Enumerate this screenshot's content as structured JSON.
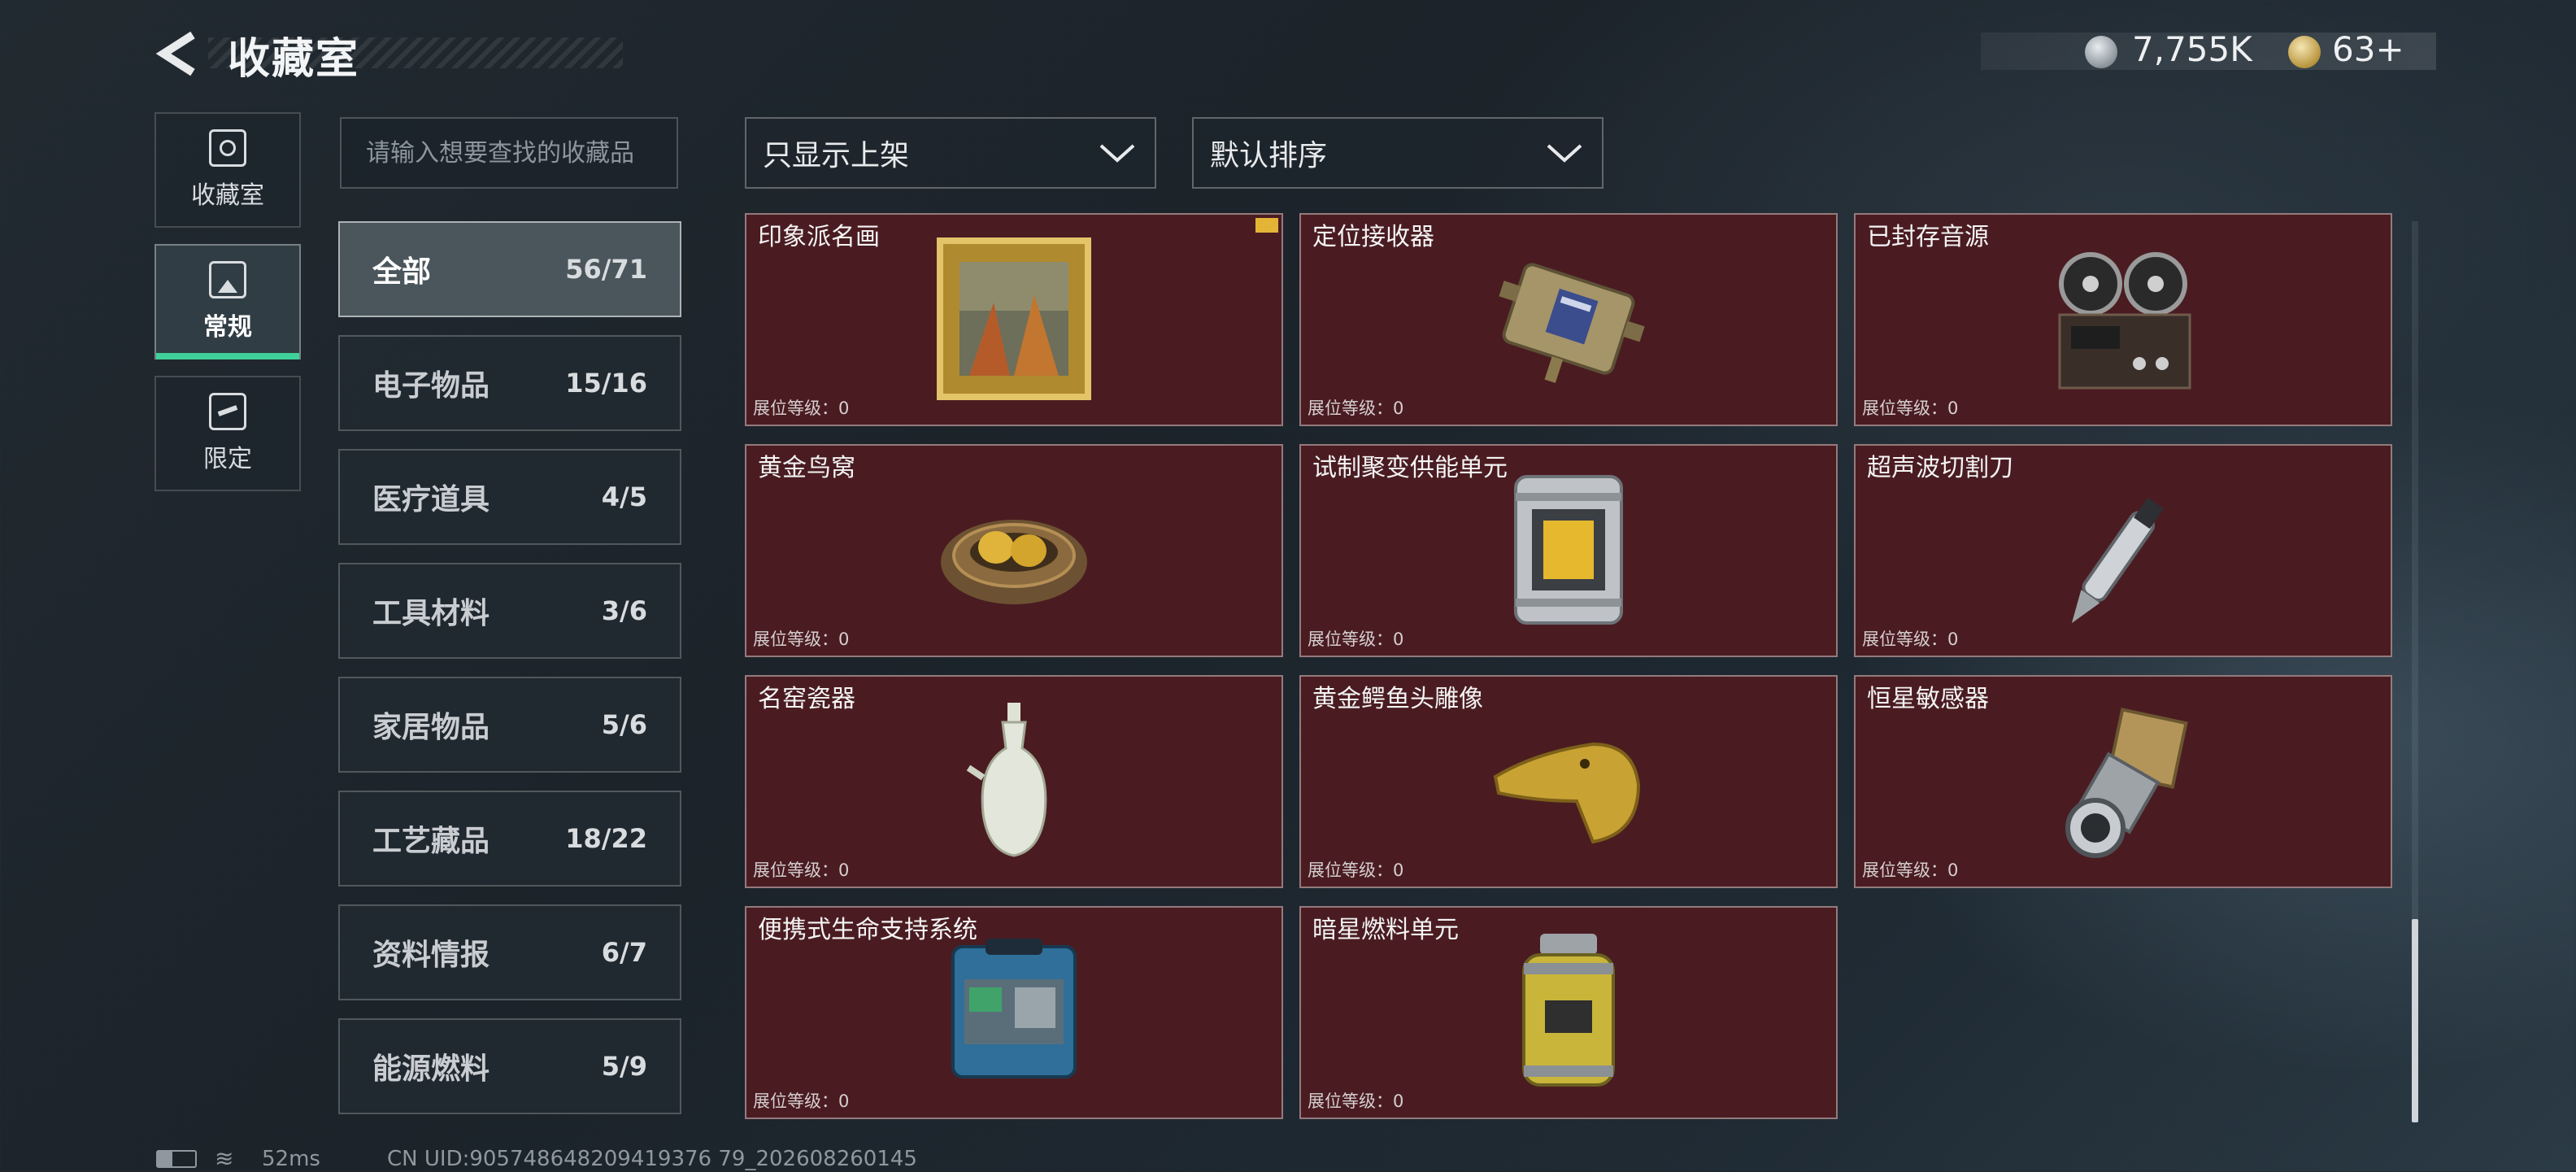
{
  "header": {
    "title": "收藏室",
    "currency_silver": "7,755K",
    "currency_gold": "63+"
  },
  "nav": [
    {
      "label": "收藏室",
      "icon": "collection-room-icon"
    },
    {
      "label": "常规",
      "icon": "regular-icon"
    },
    {
      "label": "限定",
      "icon": "limited-icon"
    }
  ],
  "search": {
    "placeholder": "请输入想要查找的收藏品"
  },
  "categories": [
    {
      "name": "全部",
      "count": "56/71"
    },
    {
      "name": "电子物品",
      "count": "15/16"
    },
    {
      "name": "医疗道具",
      "count": "4/5"
    },
    {
      "name": "工具材料",
      "count": "3/6"
    },
    {
      "name": "家居物品",
      "count": "5/6"
    },
    {
      "name": "工艺藏品",
      "count": "18/22"
    },
    {
      "name": "资料情报",
      "count": "6/7"
    },
    {
      "name": "能源燃料",
      "count": "5/9"
    }
  ],
  "filters": {
    "listing": "只显示上架",
    "sort": "默认排序"
  },
  "level_label": "展位等级：0",
  "items": [
    {
      "name": "印象派名画",
      "icon": "impressionist-painting-icon"
    },
    {
      "name": "定位接收器",
      "icon": "locator-receiver-icon"
    },
    {
      "name": "已封存音源",
      "icon": "reel-to-reel-recorder-icon"
    },
    {
      "name": "黄金鸟窝",
      "icon": "golden-nest-icon"
    },
    {
      "name": "试制聚变供能单元",
      "icon": "fusion-power-unit-icon"
    },
    {
      "name": "超声波切割刀",
      "icon": "ultrasonic-cutter-icon"
    },
    {
      "name": "名窑瓷器",
      "icon": "porcelain-vase-icon"
    },
    {
      "name": "黄金鳄鱼头雕像",
      "icon": "golden-crocodile-head-icon"
    },
    {
      "name": "恒星敏感器",
      "icon": "star-sensor-icon"
    },
    {
      "name": "便携式生命支持系统",
      "icon": "portable-life-support-icon"
    },
    {
      "name": "暗星燃料单元",
      "icon": "darkstar-fuel-cell-icon"
    }
  ],
  "status": {
    "ping": "52ms",
    "uid": "CN UID:905748648209419376 79_202608260145"
  }
}
